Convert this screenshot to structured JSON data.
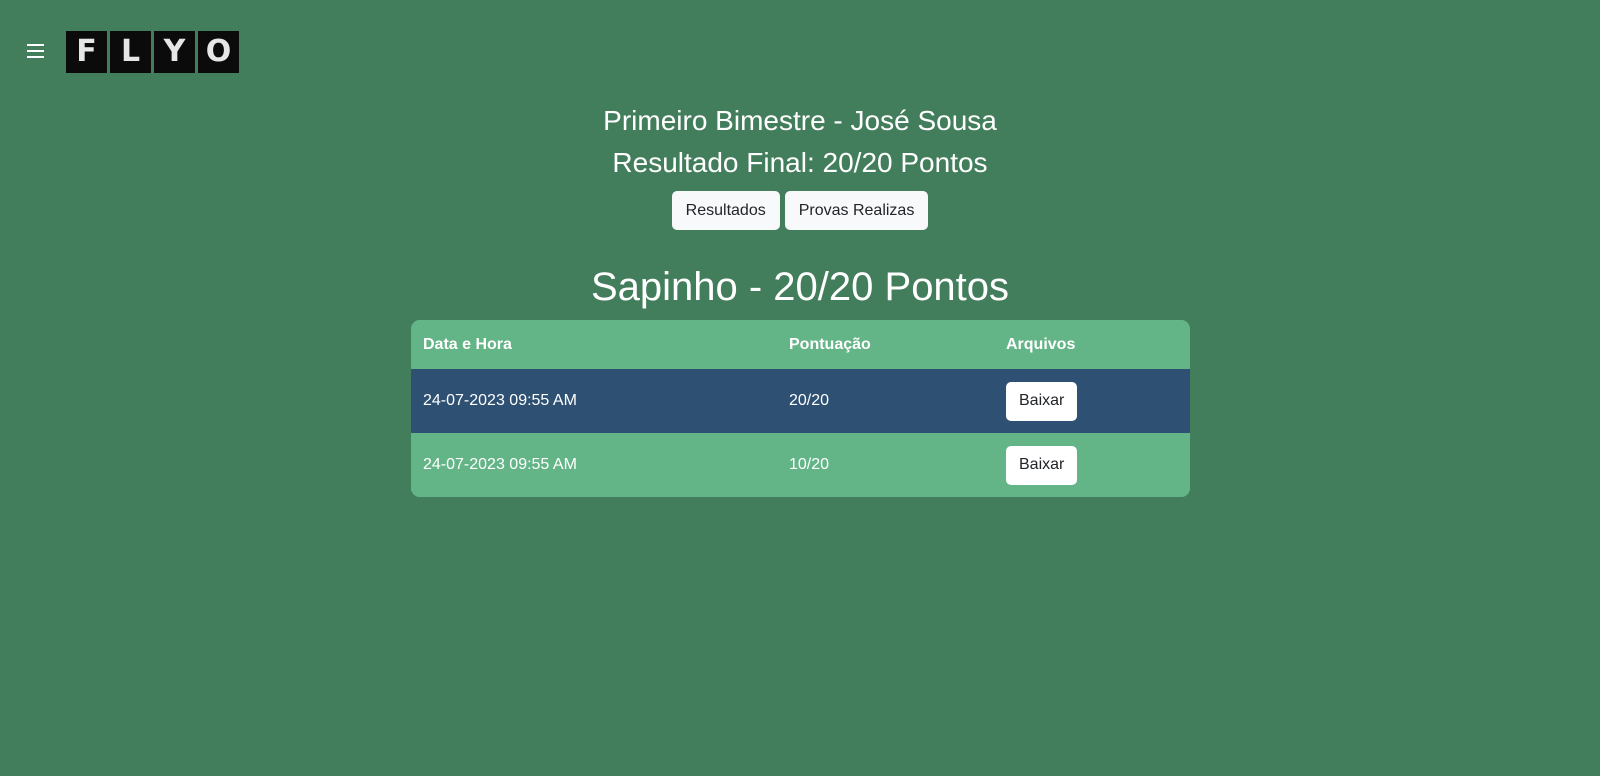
{
  "header": {
    "menu_icon": "hamburger-menu-icon",
    "logo_letters": [
      "F",
      "L",
      "Y",
      "O"
    ]
  },
  "page": {
    "title": "Primeiro Bimestre - José Sousa",
    "subtitle": "Resultado Final: 20/20 Pontos"
  },
  "tabs": {
    "results_label": "Resultados",
    "exams_label": "Provas Realizas"
  },
  "section": {
    "title": "Sapinho - 20/20 Pontos"
  },
  "table": {
    "headers": [
      "Data e Hora",
      "Pontuação",
      "Arquivos"
    ],
    "rows": [
      {
        "datetime": "24-07-2023 09:55 AM",
        "score": "20/20",
        "action": "Baixar"
      },
      {
        "datetime": "24-07-2023 09:55 AM",
        "score": "10/20",
        "action": "Baixar"
      }
    ]
  },
  "colors": {
    "background": "#437e5c",
    "table_light": "#63b587",
    "table_dark": "#2e5073",
    "button_bg": "#f8f9fa"
  }
}
